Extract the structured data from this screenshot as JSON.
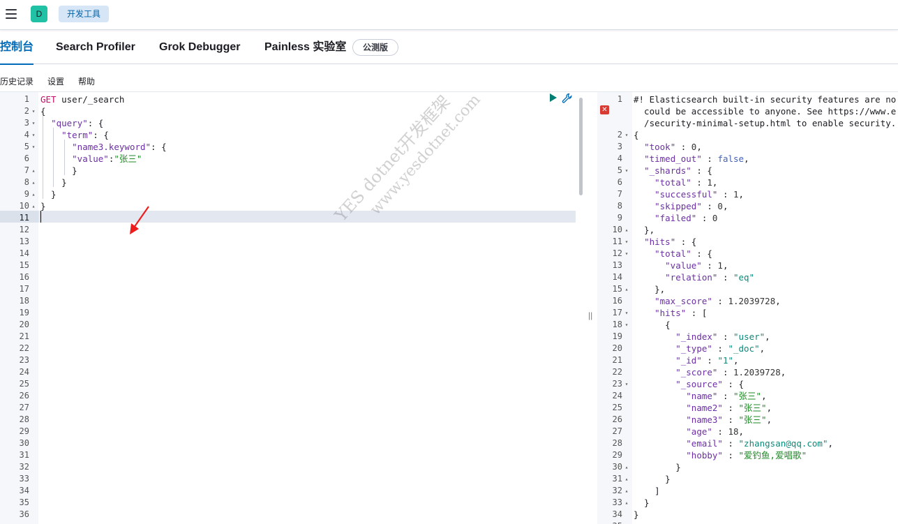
{
  "header": {
    "space_initial": "D",
    "breadcrumb": "开发工具"
  },
  "tabs": [
    {
      "label": "控制台"
    },
    {
      "label": "Search Profiler"
    },
    {
      "label": "Grok Debugger"
    },
    {
      "label": "Painless 实验室"
    }
  ],
  "beta_badge": "公测版",
  "subnav": {
    "history": "历史记录",
    "settings": "设置",
    "help": "帮助"
  },
  "request": {
    "lines": [
      "GET user/_search",
      "{",
      "  \"query\": {",
      "    \"term\": {",
      "      \"name3.keyword\": {",
      "      \"value\":\"张三\"",
      "      }",
      "    }",
      "  }",
      "}",
      ""
    ],
    "total_line_numbers": 36
  },
  "response": {
    "warning_lines": [
      "#! Elasticsearch built-in security features are no",
      "  could be accessible to anyone. See https://www.e",
      "  /security-minimal-setup.html to enable security."
    ],
    "lines": [
      "{",
      "  \"took\" : 0,",
      "  \"timed_out\" : false,",
      "  \"_shards\" : {",
      "    \"total\" : 1,",
      "    \"successful\" : 1,",
      "    \"skipped\" : 0,",
      "    \"failed\" : 0",
      "  },",
      "  \"hits\" : {",
      "    \"total\" : {",
      "      \"value\" : 1,",
      "      \"relation\" : \"eq\"",
      "    },",
      "    \"max_score\" : 1.2039728,",
      "    \"hits\" : [",
      "      {",
      "        \"_index\" : \"user\",",
      "        \"_type\" : \"_doc\",",
      "        \"_id\" : \"1\",",
      "        \"_score\" : 1.2039728,",
      "        \"_source\" : {",
      "          \"name\" : \"张三\",",
      "          \"name2\" : \"张三\",",
      "          \"name3\" : \"张三\",",
      "          \"age\" : 18,",
      "          \"email\" : \"zhangsan@qq.com\",",
      "          \"hobby\" : \"爱钓鱼,爱唱歌\"",
      "        }",
      "      }",
      "    ]",
      "  }",
      "}"
    ]
  },
  "watermark": {
    "line1": "YES dotnet开发框架",
    "line2": "www.yesdotnet.com"
  },
  "colors": {
    "accent": "#006bb8",
    "avatar": "#20c1a4",
    "breadcrumb_bg": "#d6e6f7",
    "run": "#017d73",
    "error": "#d93a32"
  }
}
